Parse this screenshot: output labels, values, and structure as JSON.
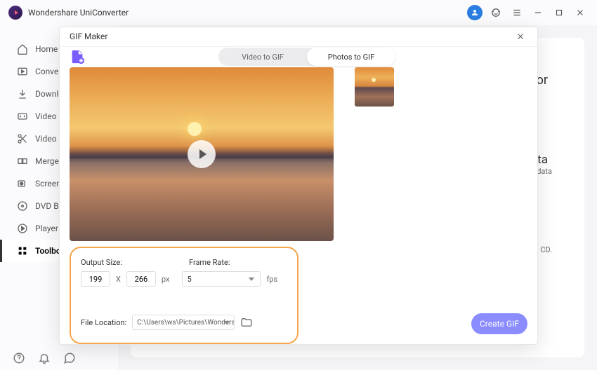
{
  "app": {
    "title": "Wondershare UniConverter"
  },
  "sidebar": {
    "items": [
      {
        "label": "Home"
      },
      {
        "label": "Converter"
      },
      {
        "label": "Downloader"
      },
      {
        "label": "Video Compressor"
      },
      {
        "label": "Video Editor"
      },
      {
        "label": "Merger"
      },
      {
        "label": "Screen Recorder"
      },
      {
        "label": "DVD Burner"
      },
      {
        "label": "Player"
      },
      {
        "label": "Toolbox"
      }
    ]
  },
  "bg": {
    "title": "tor",
    "sub": "data",
    "txt": "etadata",
    "txt2": "CD."
  },
  "modal": {
    "title": "GIF Maker",
    "tabs": {
      "video": "Video to GIF",
      "photos": "Photos to GIF"
    },
    "settings": {
      "output_label": "Output Size:",
      "width": "199",
      "height": "266",
      "x": "X",
      "px": "px",
      "frame_label": "Frame Rate:",
      "frame_value": "5",
      "fps": "fps",
      "location_label": "File Location:",
      "location_path": "C:\\Users\\ws\\Pictures\\Wonders"
    },
    "create": "Create GIF"
  }
}
